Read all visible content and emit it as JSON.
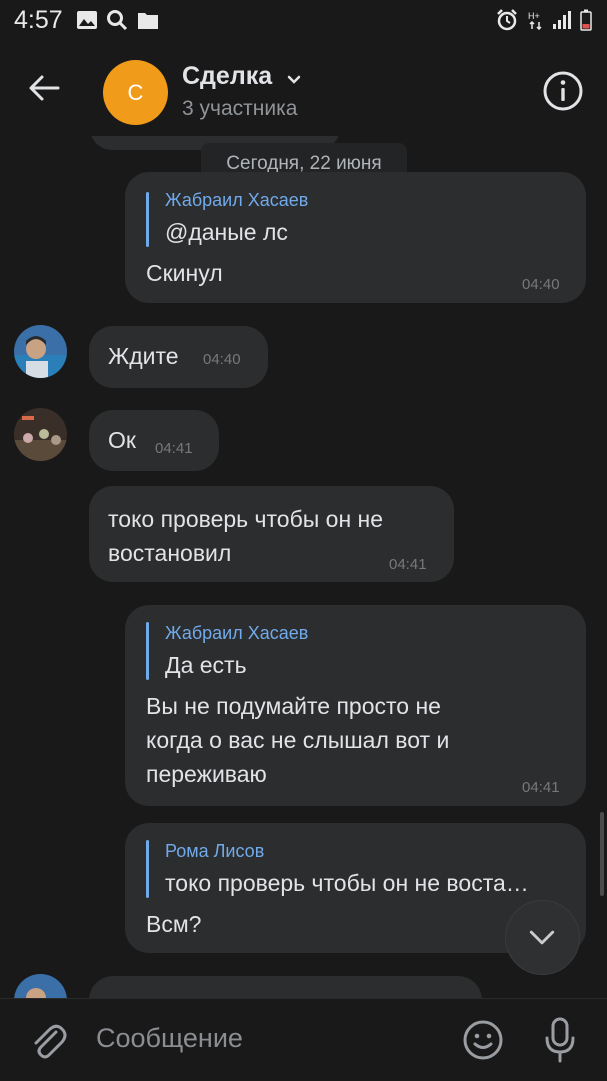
{
  "status_bar": {
    "time": "4:57"
  },
  "header": {
    "avatar_letter": "С",
    "title": "Сделка",
    "subtitle": "3 участника"
  },
  "date_separator": "Сегодня, 22 июня",
  "messages": [
    {
      "reply_name": "Жабраил Хасаев",
      "reply_text": "@даные лс",
      "text": "Скинул",
      "time": "04:40"
    },
    {
      "text": "Ждите",
      "time": "04:40"
    },
    {
      "text": "Ок",
      "time": "04:41"
    },
    {
      "text_line1": "токо проверь чтобы он не",
      "text_line2": "востановил",
      "time": "04:41"
    },
    {
      "reply_name": "Жабраил Хасаев",
      "reply_text": "Да есть",
      "text_line1": "Вы не подумайте просто не",
      "text_line2": "когда о вас не слышал вот и",
      "text_line3": "переживаю",
      "time": "04:41"
    },
    {
      "reply_name": "Рома Лисов",
      "reply_text": "токо проверь чтобы он не воста…",
      "text": "Всм?"
    }
  ],
  "composer": {
    "placeholder": "Сообщение"
  },
  "colors": {
    "background": "#191919",
    "bubble": "#2c2d2e",
    "accent": "#71aaeb",
    "avatar": "#f19b1a"
  }
}
